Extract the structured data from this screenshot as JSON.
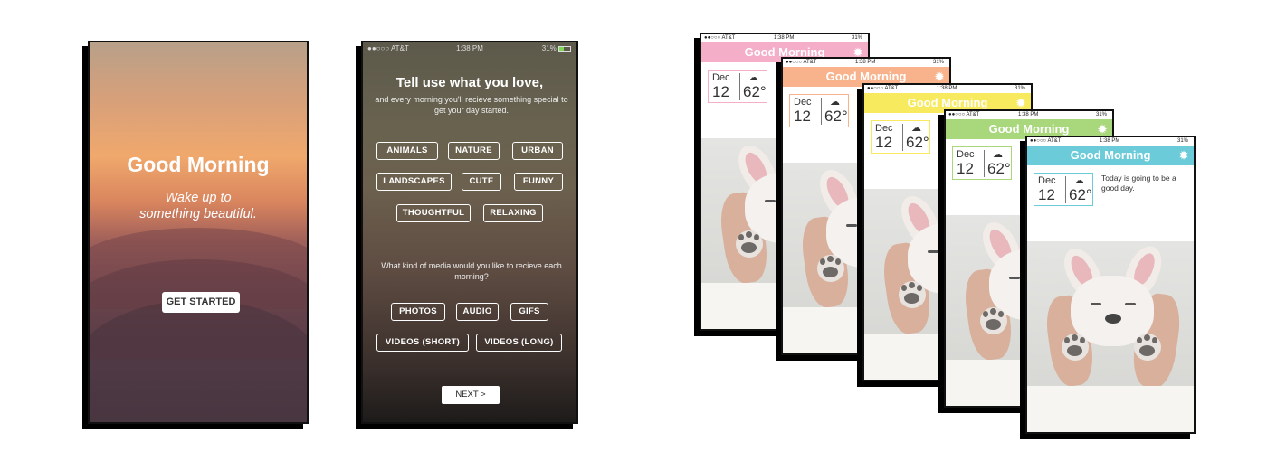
{
  "welcome": {
    "title": "Good Morning",
    "subtitle_line1": "Wake up to",
    "subtitle_line2": "something beautiful.",
    "button": "GET STARTED"
  },
  "status": {
    "carrier": "●●○○○ AT&T",
    "time": "1:38 PM",
    "battery": "31%"
  },
  "preferences": {
    "title": "Tell use what you love,",
    "description": "and every morning you'll recieve something special to get your day started.",
    "interests": [
      "ANIMALS",
      "NATURE",
      "URBAN",
      "LANDSCAPES",
      "CUTE",
      "FUNNY",
      "THOUGHTFUL",
      "RELAXING"
    ],
    "media_question": "What kind of media would you like to recieve each morning?",
    "media": [
      "PHOTOS",
      "AUDIO",
      "GIFS",
      "VIDEOS (SHORT)",
      "VIDEOS (LONG)"
    ],
    "next": "NEXT >"
  },
  "daily": {
    "title": "Good Morning",
    "month": "Dec",
    "day": "12",
    "temp": "62°",
    "message": "Today is going to be a good day.",
    "theme_colors": [
      "#f4aec8",
      "#f8b38c",
      "#f7ea5e",
      "#a8d77c",
      "#6ccbd8"
    ],
    "gear_icon": "gear-icon",
    "weather_icon": "partly-cloudy-icon"
  }
}
